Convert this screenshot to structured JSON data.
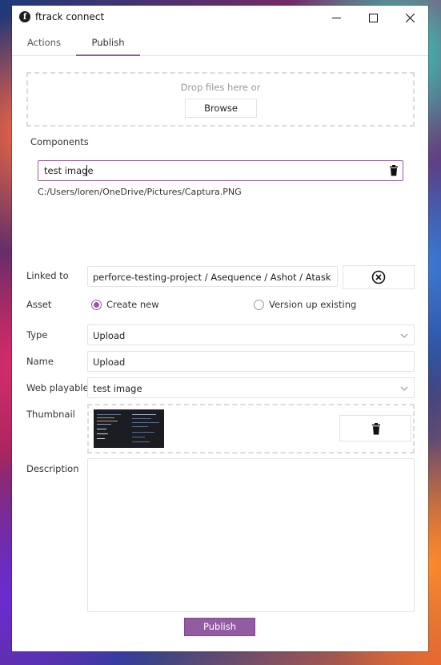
{
  "window": {
    "title": "ftrack connect",
    "logo_letter": "f",
    "buttons": {
      "minimize": "minimize-icon",
      "maximize": "maximize-icon",
      "close": "close-icon"
    }
  },
  "tabs": [
    {
      "label": "Actions",
      "active": false
    },
    {
      "label": "Publish",
      "active": true
    }
  ],
  "dropzone": {
    "text": "Drop files here or",
    "browse_label": "Browse"
  },
  "components": {
    "label": "Components",
    "items": [
      {
        "name": "test image",
        "path": "C:/Users/loren/OneDrive/Pictures/Captura.PNG"
      }
    ]
  },
  "form": {
    "linked_to": {
      "label": "Linked to",
      "value": "perforce-testing-project / Asequence / Ashot / Atask"
    },
    "asset": {
      "label": "Asset",
      "options": [
        {
          "label": "Create new",
          "selected": true
        },
        {
          "label": "Version up existing",
          "selected": false
        }
      ]
    },
    "type": {
      "label": "Type",
      "value": "Upload"
    },
    "name": {
      "label": "Name",
      "value": "Upload"
    },
    "web_playable": {
      "label": "Web playable",
      "value": "test image"
    },
    "thumbnail": {
      "label": "Thumbnail"
    },
    "description": {
      "label": "Description",
      "value": ""
    }
  },
  "publish_label": "Publish",
  "colors": {
    "accent": "#935ba2",
    "border": "#e3e3e3",
    "dashed": "#dcdcdc"
  }
}
